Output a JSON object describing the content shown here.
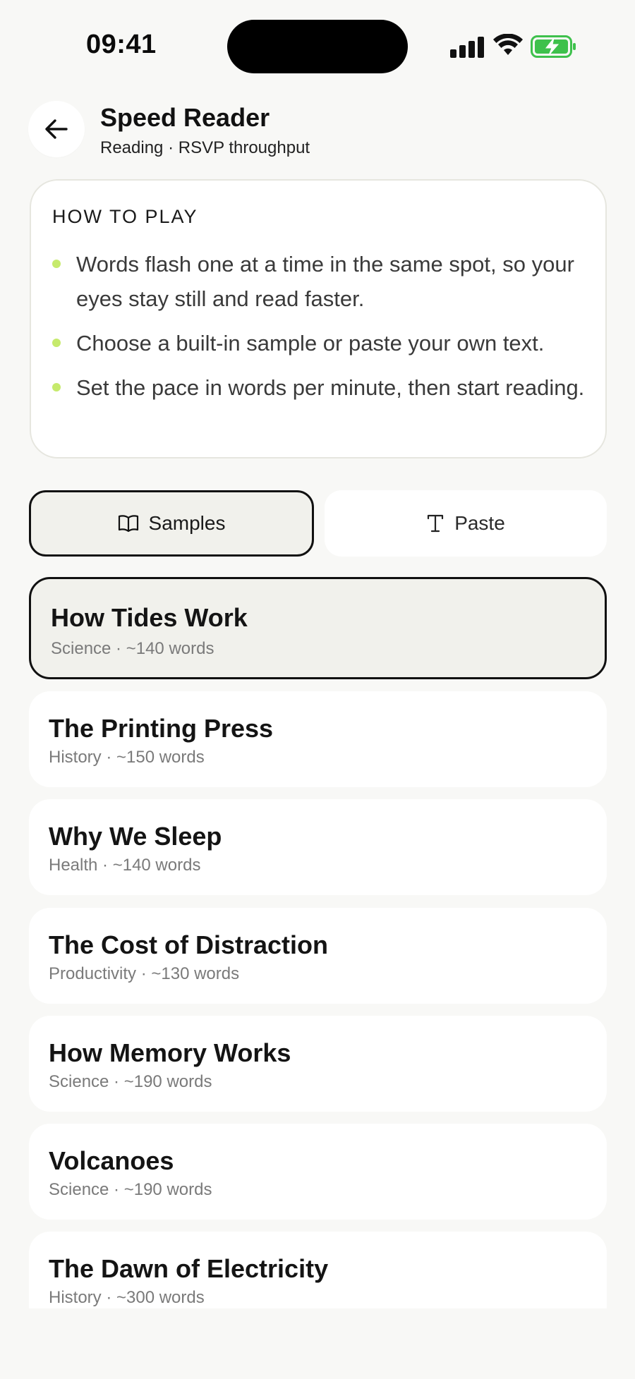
{
  "status": {
    "time": "09:41"
  },
  "header": {
    "title": "Speed Reader",
    "subtitle": "Reading · RSVP throughput"
  },
  "howto": {
    "heading": "HOW TO PLAY",
    "items": [
      "Words flash one at a time in the same spot, so your eyes stay still and read faster.",
      "Choose a built-in sample or paste your own text.",
      "Set the pace in words per minute, then start reading."
    ]
  },
  "tabs": {
    "samples_label": "Samples",
    "paste_label": "Paste",
    "selected": "Samples"
  },
  "samples": [
    {
      "title": "How Tides Work",
      "meta": "Science · ~140 words",
      "selected": true
    },
    {
      "title": "The Printing Press",
      "meta": "History · ~150 words"
    },
    {
      "title": "Why We Sleep",
      "meta": "Health · ~140 words"
    },
    {
      "title": "The Cost of Distraction",
      "meta": "Productivity · ~130 words"
    },
    {
      "title": "How Memory Works",
      "meta": "Science · ~190 words"
    },
    {
      "title": "Volcanoes",
      "meta": "Science · ~190 words"
    },
    {
      "title": "The Dawn of Electricity",
      "meta": "History · ~300 words"
    }
  ],
  "colors": {
    "bullet_accent": "#c6ea6c",
    "battery_green": "#3ec14c",
    "selected_fill": "#f1f1ec"
  }
}
